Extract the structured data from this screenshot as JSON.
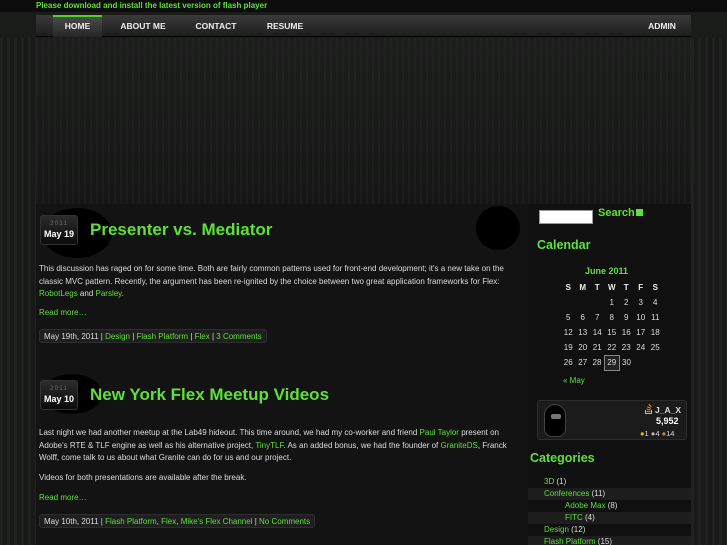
{
  "flash_notice": "Please download and install the latest version of flash player",
  "nav": {
    "items": [
      "HOME",
      "ABOUT ME",
      "CONTACT",
      "RESUME"
    ],
    "admin": "ADMIN"
  },
  "posts": [
    {
      "year": "2011",
      "day": "May 19",
      "title": "Presenter vs. Mediator",
      "body_parts": [
        "This discussion has raged on for some time. Both are fairly common patterns used for front-end development; it's a new take on the classic MVC pattern. Recently, the argument has been re-ignited by the choice between two great application frameworks for Flex: ",
        "RobotLegs",
        " and ",
        "Parsley",
        "."
      ],
      "read_more": "Read more…",
      "meta_date": "May 19th, 2011 | ",
      "meta_tags": [
        "Design",
        "Flash Platform",
        "Flex"
      ],
      "meta_comments": "3 Comments"
    },
    {
      "year": "2011",
      "day": "May 10",
      "title": "New York Flex Meetup Videos",
      "body_parts": [
        "Last night we had another meetup at the Lab49 hideout. This time around, we had my co-worker and friend ",
        "Paul Taylor",
        " present on Adobe's RTE & TLF engine as well as his alternative project, ",
        "TinyTLF",
        ". As an added bonus, we had the founder of ",
        "GraniteDS",
        ", Franck Wolff, come talk to us about what Granite can do for us and our project."
      ],
      "body2": "Videos for both presentations are available after the break.",
      "read_more": "Read more…",
      "meta_date": "May 10th, 2011 | ",
      "meta_tags": [
        "Flash Platform",
        "Flex",
        "Mike's Flex Channel"
      ],
      "meta_comments": "No Comments"
    }
  ],
  "sidebar": {
    "search_label": "Search",
    "calendar_title": "Calendar",
    "calendar_caption": "June 2011",
    "weekdays": [
      "S",
      "M",
      "T",
      "W",
      "T",
      "F",
      "S"
    ],
    "weeks": [
      [
        "",
        "",
        "",
        "1",
        "2",
        "3",
        "4"
      ],
      [
        "5",
        "6",
        "7",
        "8",
        "9",
        "10",
        "11"
      ],
      [
        "12",
        "13",
        "14",
        "15",
        "16",
        "17",
        "18"
      ],
      [
        "19",
        "20",
        "21",
        "22",
        "23",
        "24",
        "25"
      ],
      [
        "26",
        "27",
        "28",
        "29",
        "30",
        "",
        ""
      ]
    ],
    "today": "29",
    "prev_month": "« May",
    "profile": {
      "name": "J_A_X",
      "reputation": "5,952",
      "badges": "●1 ●4 ●14",
      "colors": {
        "gold": "#e8c300",
        "silver": "#bbbbbb",
        "bronze": "#c08a5a"
      }
    },
    "categories_title": "Categories",
    "categories": [
      {
        "name": "3D",
        "count": "(1)",
        "indent": 0
      },
      {
        "name": "Conferences",
        "count": "(11)",
        "indent": 0
      },
      {
        "name": "Adobe Max",
        "count": "(8)",
        "indent": 1
      },
      {
        "name": "FITC",
        "count": "(4)",
        "indent": 1
      },
      {
        "name": "Design",
        "count": "(12)",
        "indent": 0
      },
      {
        "name": "Flash Platform",
        "count": "(15)",
        "indent": 0
      }
    ]
  },
  "colors": {
    "accent": "#5ee03a",
    "background": "#121312"
  }
}
